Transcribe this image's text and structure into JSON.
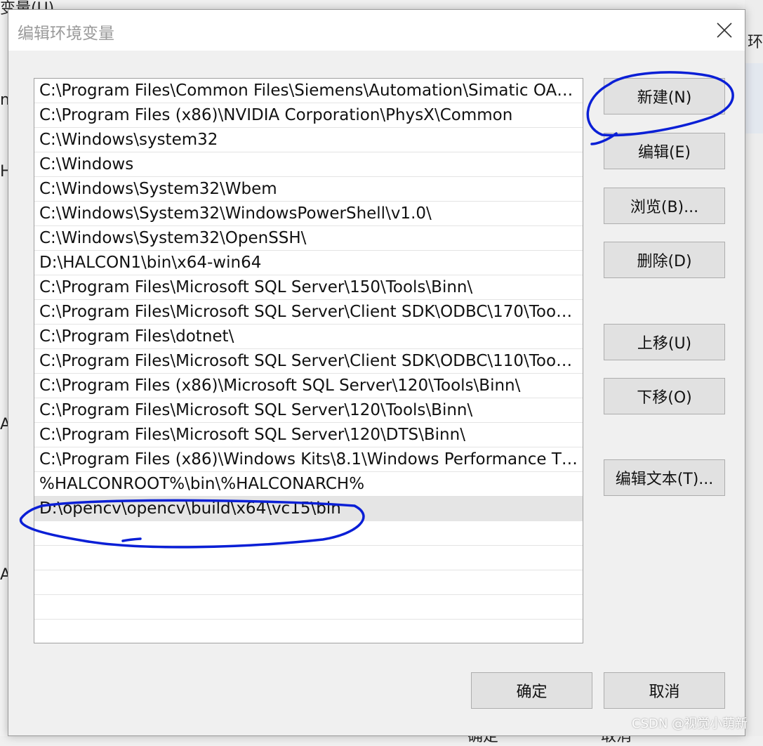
{
  "background": {
    "top_left_text": "变量(U)",
    "left_fragments": [
      "ns",
      "H",
      "A",
      "A"
    ],
    "right_fragment": "环",
    "bottom_fragments": [
      "确定",
      "取消"
    ]
  },
  "dialog": {
    "title": "编辑环境变量",
    "close_icon": "close-icon"
  },
  "paths": [
    "C:\\Program Files\\Common Files\\Siemens\\Automation\\Simatic OA…",
    "C:\\Program Files (x86)\\NVIDIA Corporation\\PhysX\\Common",
    "C:\\Windows\\system32",
    "C:\\Windows",
    "C:\\Windows\\System32\\Wbem",
    "C:\\Windows\\System32\\WindowsPowerShell\\v1.0\\",
    "C:\\Windows\\System32\\OpenSSH\\",
    "D:\\HALCON1\\bin\\x64-win64",
    "C:\\Program Files\\Microsoft SQL Server\\150\\Tools\\Binn\\",
    "C:\\Program Files\\Microsoft SQL Server\\Client SDK\\ODBC\\170\\Too…",
    "C:\\Program Files\\dotnet\\",
    "C:\\Program Files\\Microsoft SQL Server\\Client SDK\\ODBC\\110\\Too…",
    "C:\\Program Files (x86)\\Microsoft SQL Server\\120\\Tools\\Binn\\",
    "C:\\Program Files\\Microsoft SQL Server\\120\\Tools\\Binn\\",
    "C:\\Program Files\\Microsoft SQL Server\\120\\DTS\\Binn\\",
    "C:\\Program Files (x86)\\Windows Kits\\8.1\\Windows Performance T…",
    "%HALCONROOT%\\bin\\%HALCONARCH%",
    "D:\\opencv\\opencv\\build\\x64\\vc15\\bin",
    "",
    "",
    "",
    "",
    ""
  ],
  "selected_index": 17,
  "buttons": {
    "new": "新建(N)",
    "edit": "编辑(E)",
    "browse": "浏览(B)...",
    "delete": "删除(D)",
    "move_up": "上移(U)",
    "move_down": "下移(O)",
    "edit_text": "编辑文本(T)...",
    "ok": "确定",
    "cancel": "取消"
  },
  "annotation_color": "#0a1fd6",
  "watermark": "CSDN @视觉小萌新"
}
